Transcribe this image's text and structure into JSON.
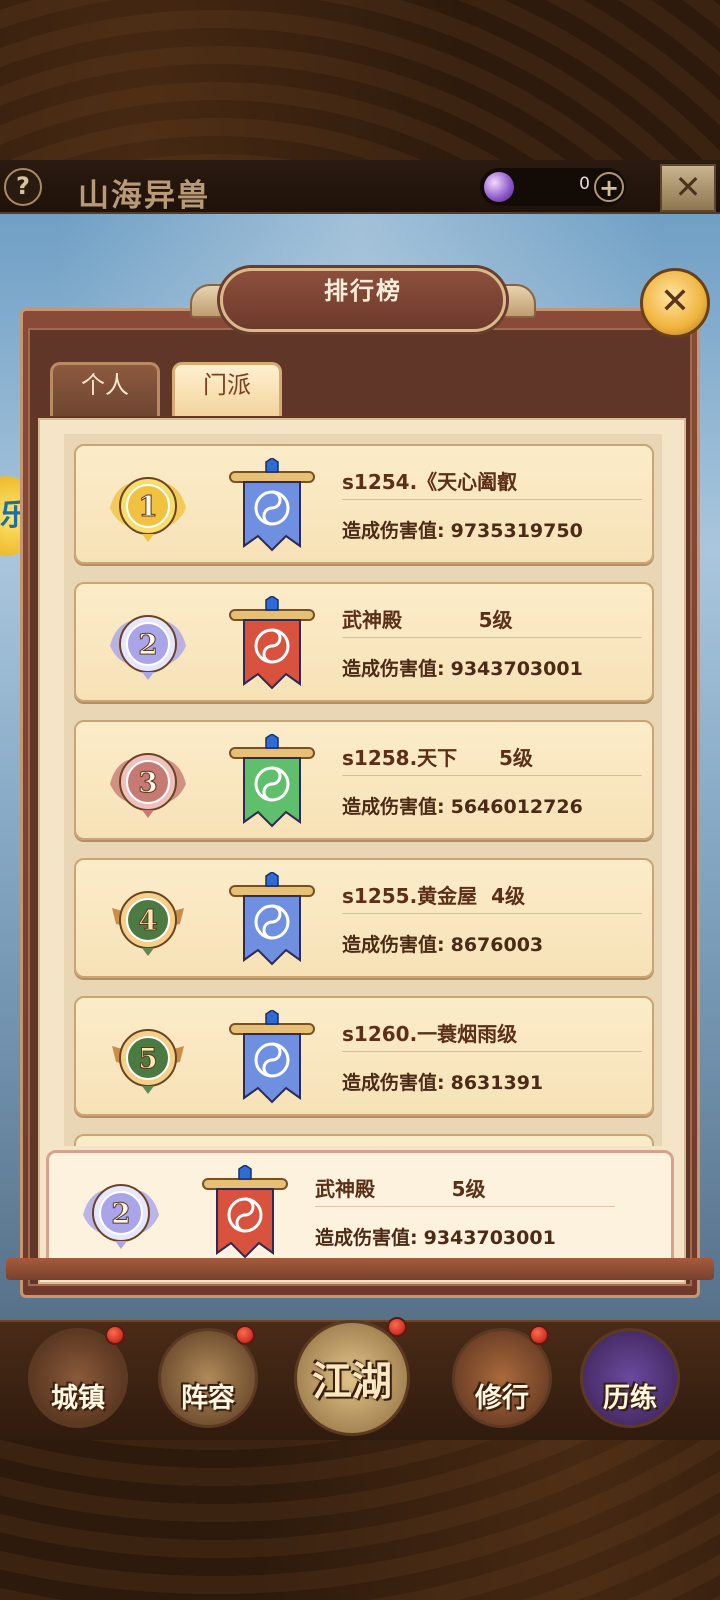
{
  "header": {
    "help_label": "?",
    "title": "山海异兽",
    "currency_value": "0",
    "add_label": "+",
    "close_label": "✕"
  },
  "side_badge": "乐",
  "popup": {
    "title": "排行榜",
    "close_label": "✕",
    "tabs": [
      {
        "label": "个人",
        "active": false
      },
      {
        "label": "门派",
        "active": true
      }
    ]
  },
  "damage_label": "造成伤害值:",
  "rankings": [
    {
      "rank": "1",
      "name": "s1254.《天心阖叡",
      "damage": "9735319750",
      "banner_color": "blue",
      "medal": "gold"
    },
    {
      "rank": "2",
      "name": "武神殿           5级",
      "damage": "9343703001",
      "banner_color": "red",
      "medal": "silver"
    },
    {
      "rank": "3",
      "name": "s1258.天下      5级",
      "damage": "5646012726",
      "banner_color": "green",
      "medal": "bronze"
    },
    {
      "rank": "4",
      "name": "s1255.黄金屋  4级",
      "damage": "8676003",
      "banner_color": "blue",
      "medal": "plain"
    },
    {
      "rank": "5",
      "name": "s1260.一蓑烟雨级",
      "damage": "8631391",
      "banner_color": "blue",
      "medal": "plain"
    }
  ],
  "my_guild": {
    "rank": "2",
    "name": "武神殿           5级",
    "damage": "9343703001",
    "banner_color": "red",
    "medal": "silver"
  },
  "bottom_nav": [
    {
      "label": "城镇",
      "has_dot": true
    },
    {
      "label": "阵容",
      "has_dot": true
    },
    {
      "label": "江湖",
      "has_dot": true
    },
    {
      "label": "修行",
      "has_dot": true
    },
    {
      "label": "历练",
      "has_dot": false
    }
  ],
  "colors": {
    "banner_blue": "#6f8fe0",
    "banner_red": "#d8523d",
    "banner_green": "#5fbf6d",
    "medal_gold": "#f1c23f",
    "medal_silver": "#a9a5e8",
    "medal_bronze": "#c77a74",
    "medal_plain": "#5e8a52"
  }
}
